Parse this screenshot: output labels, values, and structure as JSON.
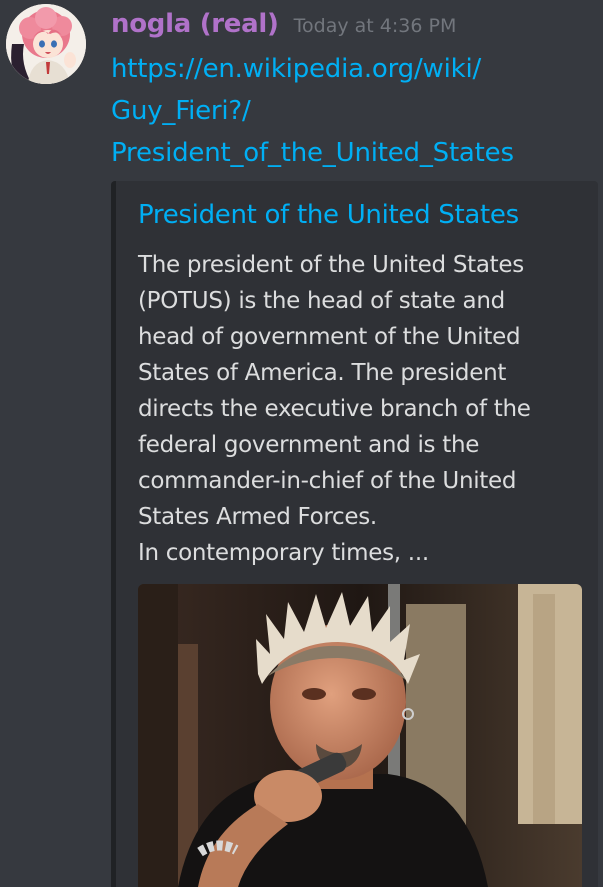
{
  "message": {
    "username": "nogla (real)",
    "timestamp": "Today at 4:36 PM",
    "link_lines": [
      "https://en.wikipedia.org/wiki/",
      "Guy_Fieri?/",
      "President_of_the_United_States"
    ]
  },
  "embed": {
    "title": "President of the United States",
    "description_lines": [
      "The president of the United States",
      "(POTUS) is the head of state and",
      "head of government of the United",
      "States of America. The president",
      "directs the executive branch of the",
      "federal government and is the",
      "commander-in-chief of the United",
      "States Armed Forces.",
      "In contemporary times, ..."
    ]
  },
  "colors": {
    "background": "#36393f",
    "embed_background": "#2f3136",
    "username": "#b072c9",
    "link": "#00aff4",
    "text": "#dcddde",
    "timestamp": "#72767d"
  },
  "icons": {
    "avatar": "anime-avatar-pink-hair",
    "embed_image": "photo-spiky-blond-man-with-microphone"
  }
}
